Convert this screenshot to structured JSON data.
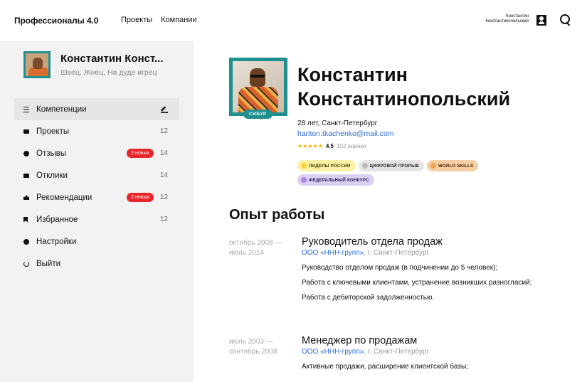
{
  "header": {
    "logo_text": "Профессионалы",
    "logo_version": "4.0",
    "nav": [
      "Проекты",
      "Компании"
    ],
    "user_first": "Константин",
    "user_last": "Константинопольский"
  },
  "sidebar": {
    "name": "Константин Конст...",
    "subtitle": "Швец, Жнец, На дуде игрец",
    "items": [
      {
        "label": "Компетенции",
        "icon": "list-icon",
        "count": "",
        "badge": "",
        "active": true
      },
      {
        "label": "Проекты",
        "icon": "folder-icon",
        "count": "12",
        "badge": ""
      },
      {
        "label": "Отзывы",
        "icon": "chat-icon",
        "count": "14",
        "badge": "2 новых"
      },
      {
        "label": "Отклики",
        "icon": "mail-icon",
        "count": "14",
        "badge": ""
      },
      {
        "label": "Рекомендации",
        "icon": "thumb-up-icon",
        "count": "12",
        "badge": "2 новых"
      },
      {
        "label": "Избранное",
        "icon": "bookmark-icon",
        "count": "12",
        "badge": ""
      },
      {
        "label": "Настройки",
        "icon": "gear-icon",
        "count": "",
        "badge": ""
      },
      {
        "label": "Выйти",
        "icon": "power-icon",
        "count": "",
        "badge": ""
      }
    ]
  },
  "profile": {
    "company_badge": "СИБУР",
    "first_name": "Константин",
    "last_name": "Константинопольский",
    "age_city": "28 лет, Санкт-Петербург",
    "email": "hariton.tkachenko@mail.com",
    "stars": "★★★★★",
    "rating": "4.5",
    "reviews": "102 оценки",
    "tags": [
      "ЛИДЕРЫ РОССИИ",
      "ЦИФРОВОЙ ПРОРЫВ",
      "WORLD SKILLS",
      "ФЕДЕРАЛЬНЫЙ КОНКУРС"
    ]
  },
  "experience": {
    "title": "Опыт работы",
    "jobs": [
      {
        "date_from": "октябрь 2008 —",
        "date_to": "июль 2014",
        "position": "Руководитель отдела продаж",
        "company": "ООО «ННН-групп»",
        "city": ", г. Санкт-Петербург",
        "duties": [
          "Руководство отделом продаж (в подчинении до 5 человек);",
          "Работа с ключевыми клиентами, устранение возникших разногласий;",
          "Работа с дебиторской задолженностью."
        ]
      },
      {
        "date_from": "июль 2003 —",
        "date_to": "сентябрь 2008",
        "position": "Менеджер по продажам",
        "company": "ООО «ННН-групп»",
        "city": ", г. Санкт-Петербург",
        "duties": [
          "Активные продажи, расширение клиентской базы;"
        ]
      }
    ]
  },
  "colors": {
    "accent_teal": "#1f8f8f",
    "link_blue": "#2a6bd8",
    "badge_red": "#e8262b"
  }
}
